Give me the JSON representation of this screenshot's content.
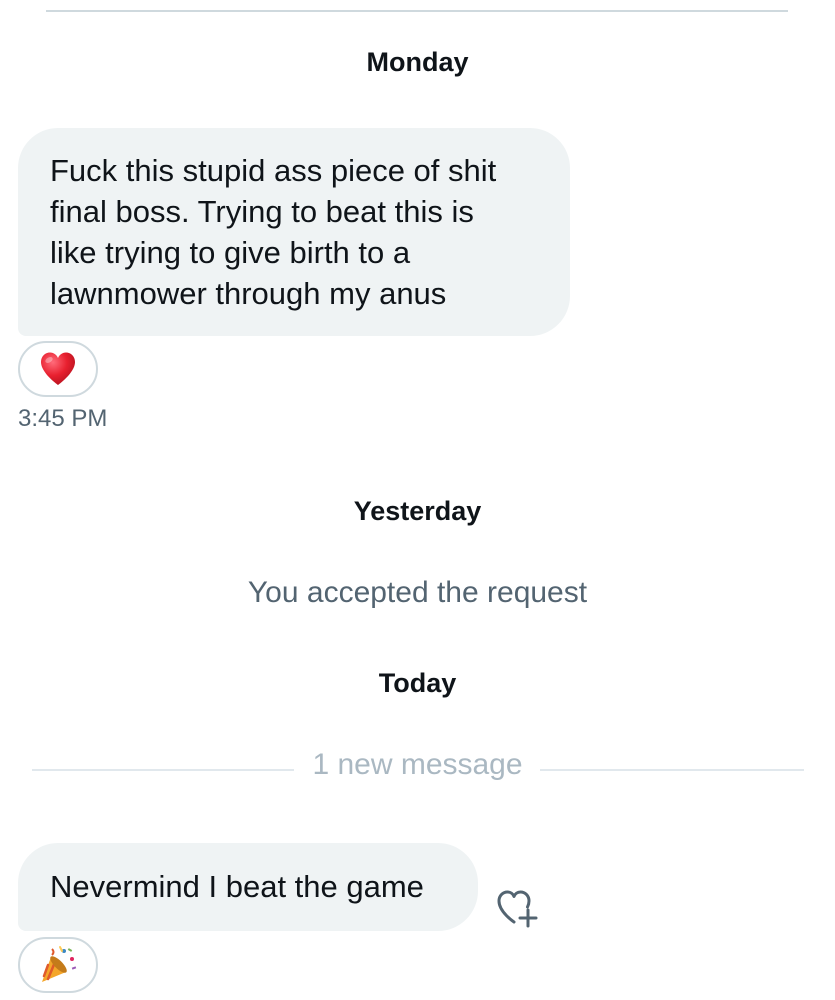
{
  "conversation": {
    "groups": [
      {
        "date": "Monday",
        "message": "Fuck this stupid ass piece of shit\nfinal boss. Trying to beat this is\nlike trying to give birth to a\nlawnmower through my anus",
        "reaction": "heart",
        "timestamp": "3:45 PM"
      },
      {
        "date": "Yesterday",
        "system_message": "You accepted the request"
      },
      {
        "date": "Today",
        "divider": "1 new message",
        "message": "Nevermind I beat the game",
        "reaction": "party-popper"
      }
    ]
  },
  "colors": {
    "bubble_bg": "#eff3f4",
    "secondary_text": "#536471",
    "divider_text": "#aab8c2",
    "heart": "#e0245e"
  }
}
